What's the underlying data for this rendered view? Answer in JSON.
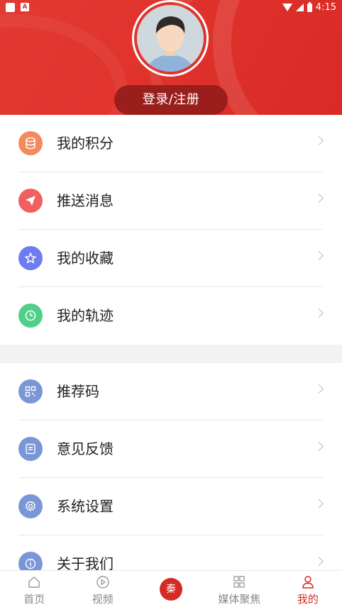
{
  "status_bar": {
    "time": "4:15",
    "a_badge": "A"
  },
  "profile": {
    "login_label": "登录/注册"
  },
  "menu_group_1": [
    {
      "label": "我的积分",
      "icon": "coins-icon",
      "color": "#f28a5c"
    },
    {
      "label": "推送消息",
      "icon": "send-icon",
      "color": "#f06060"
    },
    {
      "label": "我的收藏",
      "icon": "star-icon",
      "color": "#6d7df0"
    },
    {
      "label": "我的轨迹",
      "icon": "clock-icon",
      "color": "#4fcf8a"
    }
  ],
  "menu_group_2": [
    {
      "label": "推荐码",
      "icon": "qr-code-icon",
      "color": "#7a96d6"
    },
    {
      "label": "意见反馈",
      "icon": "feedback-icon",
      "color": "#7a96d6"
    },
    {
      "label": "系统设置",
      "icon": "gear-icon",
      "color": "#7a96d6"
    },
    {
      "label": "关于我们",
      "icon": "info-icon",
      "color": "#7a96d6"
    }
  ],
  "bottom_nav": {
    "items": [
      {
        "label": "首页",
        "icon": "home-icon"
      },
      {
        "label": "视频",
        "icon": "play-icon"
      },
      {
        "label": "",
        "icon": "center-logo-icon",
        "logo_text": "秦"
      },
      {
        "label": "媒体聚焦",
        "icon": "grid-icon"
      },
      {
        "label": "我的",
        "icon": "user-icon"
      }
    ],
    "active": "我的",
    "active_color": "#d42b26"
  }
}
